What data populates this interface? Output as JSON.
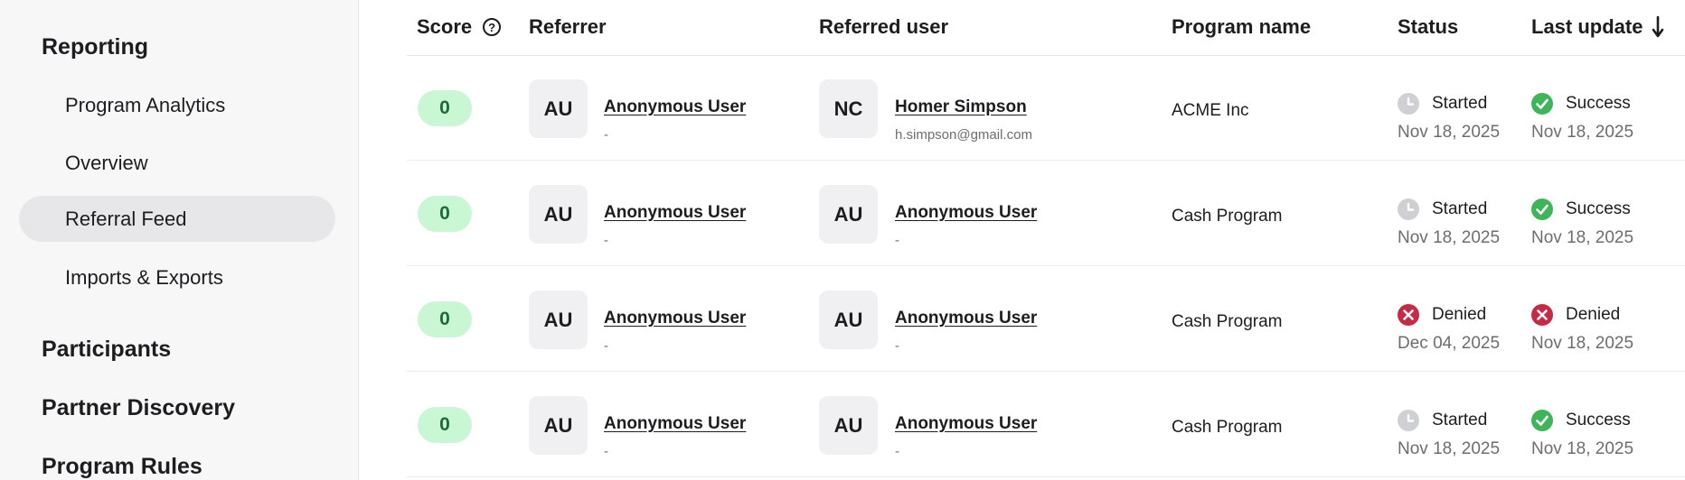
{
  "sidebar": {
    "sections": [
      {
        "label": "Reporting"
      },
      {
        "label": "Participants"
      },
      {
        "label": "Partner Discovery"
      },
      {
        "label": "Program Rules"
      }
    ],
    "items": [
      {
        "label": "Program Analytics",
        "active": false
      },
      {
        "label": "Overview",
        "active": false
      },
      {
        "label": "Referral Feed",
        "active": true
      },
      {
        "label": "Imports & Exports",
        "active": false
      }
    ]
  },
  "table": {
    "headers": {
      "score": "Score",
      "referrer": "Referrer",
      "referred_user": "Referred user",
      "program_name": "Program name",
      "status": "Status",
      "last_update": "Last update"
    },
    "rows": [
      {
        "score": "0",
        "referrer": {
          "initials": "AU",
          "name": "Anonymous User",
          "sub": "-"
        },
        "referred": {
          "initials": "NC",
          "name": "Homer Simpson",
          "sub": "h.simpson@gmail.com"
        },
        "program": "ACME Inc",
        "status": {
          "icon": "clock-icon",
          "label": "Started",
          "date": "Nov 18, 2025"
        },
        "last_update": {
          "icon": "check-icon",
          "label": "Success",
          "date": "Nov 18, 2025"
        }
      },
      {
        "score": "0",
        "referrer": {
          "initials": "AU",
          "name": "Anonymous User",
          "sub": "-"
        },
        "referred": {
          "initials": "AU",
          "name": "Anonymous User",
          "sub": "-"
        },
        "program": "Cash Program",
        "status": {
          "icon": "clock-icon",
          "label": "Started",
          "date": "Nov 18, 2025"
        },
        "last_update": {
          "icon": "check-icon",
          "label": "Success",
          "date": "Nov 18, 2025"
        }
      },
      {
        "score": "0",
        "referrer": {
          "initials": "AU",
          "name": "Anonymous User",
          "sub": "-"
        },
        "referred": {
          "initials": "AU",
          "name": "Anonymous User",
          "sub": "-"
        },
        "program": "Cash Program",
        "status": {
          "icon": "x-icon",
          "label": "Denied",
          "date": "Dec 04, 2025"
        },
        "last_update": {
          "icon": "x-icon",
          "label": "Denied",
          "date": "Nov 18, 2025"
        }
      },
      {
        "score": "0",
        "referrer": {
          "initials": "AU",
          "name": "Anonymous User",
          "sub": "-"
        },
        "referred": {
          "initials": "AU",
          "name": "Anonymous User",
          "sub": "-"
        },
        "program": "Cash Program",
        "status": {
          "icon": "clock-icon",
          "label": "Started",
          "date": "Nov 18, 2025"
        },
        "last_update": {
          "icon": "check-icon",
          "label": "Success",
          "date": "Nov 18, 2025"
        }
      }
    ]
  },
  "colors": {
    "score_bg": "#c9f6d3",
    "success": "#3fb55a",
    "denied": "#c72a45",
    "pending": "#cfd0d4"
  }
}
